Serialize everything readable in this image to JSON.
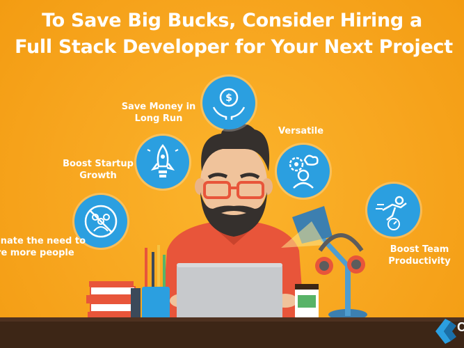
{
  "header": {
    "title_line1": "To Save Big Bucks, Consider Hiring a",
    "title_line2": "Full Stack Developer for Your Next Project"
  },
  "benefits": [
    {
      "line1": "Save Money in",
      "line2": "Long Run",
      "icon": "money-hands-icon"
    },
    {
      "line1": "Versatile",
      "line2": "",
      "icon": "gears-person-icon"
    },
    {
      "line1": "Boost Startup",
      "line2": "Growth",
      "icon": "rocket-bulb-icon"
    },
    {
      "line1": "Eliminate the need to",
      "line2": "hire more people",
      "icon": "no-team-icon"
    },
    {
      "line1": "Boost Team",
      "line2": "Productivity",
      "icon": "speed-runner-icon"
    }
  ],
  "brand": {
    "letter": "C"
  },
  "colors": {
    "background": "#f7a51e",
    "circle": "#2b9fe0",
    "shirt": "#e8553a",
    "desk": "#3d2616",
    "laptop": "#c7c9cc"
  }
}
